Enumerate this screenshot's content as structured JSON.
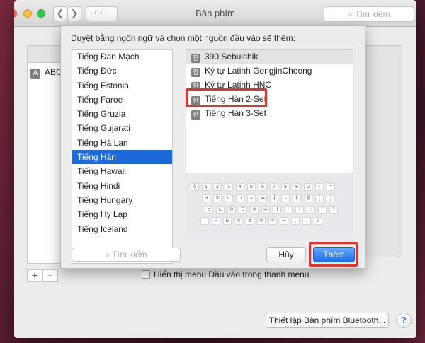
{
  "window": {
    "title": "Bàn phím",
    "search_placeholder": "Tìm kiếm",
    "nav_back": "❮",
    "nav_forward": "❯",
    "grid_icon": "⋮⋮⋮"
  },
  "background_list": {
    "item_label": "ABC",
    "item_icon": "A"
  },
  "controls": {
    "plus": "+",
    "minus": "−",
    "show_menu_label": "Hiển thị menu Đầu vào trong thanh menu",
    "bluetooth_button": "Thiết lập Bàn phím Bluetooth...",
    "help": "?"
  },
  "sheet": {
    "prompt": "Duyệt bằng ngôn ngữ và chọn một nguồn đầu vào sẽ thêm:",
    "languages": [
      "Tiếng Đan Mạch",
      "Tiếng Đức",
      "Tiếng Estonia",
      "Tiếng Faroe",
      "Tiếng Gruzia",
      "Tiếng Gujarati",
      "Tiếng Hà Lan",
      "Tiếng Hàn",
      "Tiếng Hawaii",
      "Tiếng Hindi",
      "Tiếng Hungary",
      "Tiếng Hy Lạp",
      "Tiếng Iceland"
    ],
    "selected_language": "Tiếng Hàn",
    "sources": [
      "390 Sebulshik",
      "Ký tự Latinh GongjinCheong",
      "Ký tự Latinh HNC",
      "Tiếng Hàn 2-Set",
      "Tiếng Hàn 3-Set"
    ],
    "source_icon": "한",
    "highlighted_source": "Tiếng Hàn 2-Set",
    "search_placeholder": "Tìm kiếm",
    "cancel_label": "Hủy",
    "add_label": "Thêm"
  },
  "keyboard_preview": {
    "rows": [
      [
        "§",
        "1",
        "2",
        "3",
        "4",
        "5",
        "6",
        "7",
        "8",
        "9",
        "0",
        "-",
        "="
      ],
      [
        "ㅂ",
        "ㅈ",
        "ㄷ",
        "ㄱ",
        "ㅅ",
        "ㅛ",
        "ㅕ",
        "ㅑ",
        "ㅐ",
        "ㅔ",
        "[",
        "]"
      ],
      [
        "ㅁ",
        "ㄴ",
        "ㅇ",
        "ㄹ",
        "ㅎ",
        "ㅗ",
        "ㅓ",
        "ㅏ",
        "ㅣ",
        ";",
        "'",
        "\\"
      ],
      [
        "`",
        "ㅋ",
        "ㅌ",
        "ㅊ",
        "ㅍ",
        "ㅠ",
        "ㅜ",
        "ㅡ",
        ",",
        ".",
        "/"
      ]
    ]
  },
  "colors": {
    "selection": "#1b6ad8",
    "highlight": "#e5322d",
    "primary_button": "#1a6fe8"
  }
}
